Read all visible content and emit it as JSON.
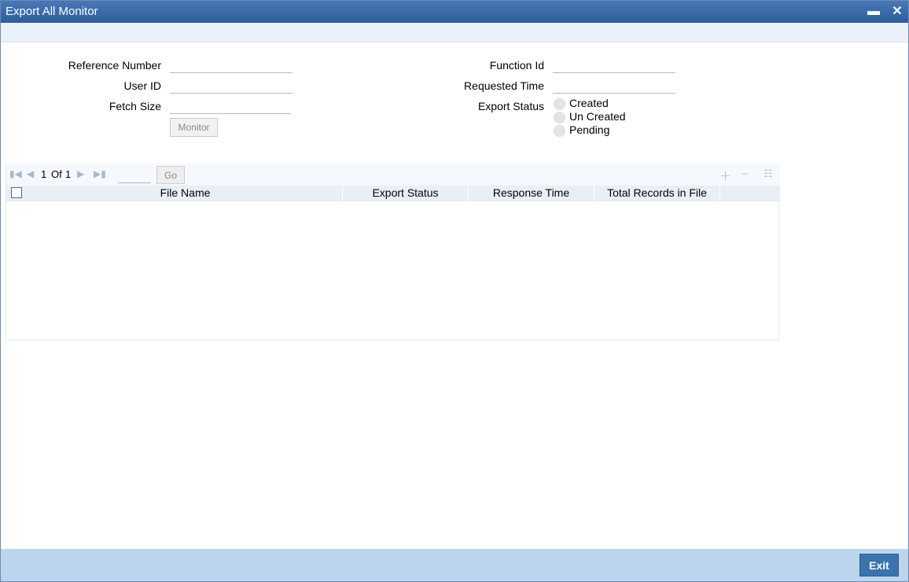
{
  "window": {
    "title": "Export All Monitor",
    "minimize_glyph": "▬",
    "close_glyph": "✕"
  },
  "form": {
    "reference_number_label": "Reference Number",
    "reference_number_value": "",
    "user_id_label": "User ID",
    "user_id_value": "",
    "fetch_size_label": "Fetch Size",
    "fetch_size_value": "",
    "monitor_button": "Monitor",
    "function_id_label": "Function Id",
    "function_id_value": "",
    "requested_time_label": "Requested Time",
    "requested_time_value": "",
    "export_status_label": "Export Status",
    "export_status_options": [
      "Created",
      "Un Created",
      "Pending"
    ]
  },
  "pager": {
    "current_page": "1",
    "of_label": "Of",
    "total_pages": "1",
    "go_button": "Go"
  },
  "grid": {
    "columns": [
      "File Name",
      "Export Status",
      "Response Time",
      "Total Records in File"
    ]
  },
  "footer": {
    "exit_button": "Exit"
  },
  "icons": {
    "first": "first-page-icon",
    "prev": "prev-page-icon",
    "next": "next-page-icon",
    "last": "last-page-icon",
    "add": "add-row-icon",
    "remove": "delete-row-icon",
    "columns": "column-settings-icon"
  }
}
